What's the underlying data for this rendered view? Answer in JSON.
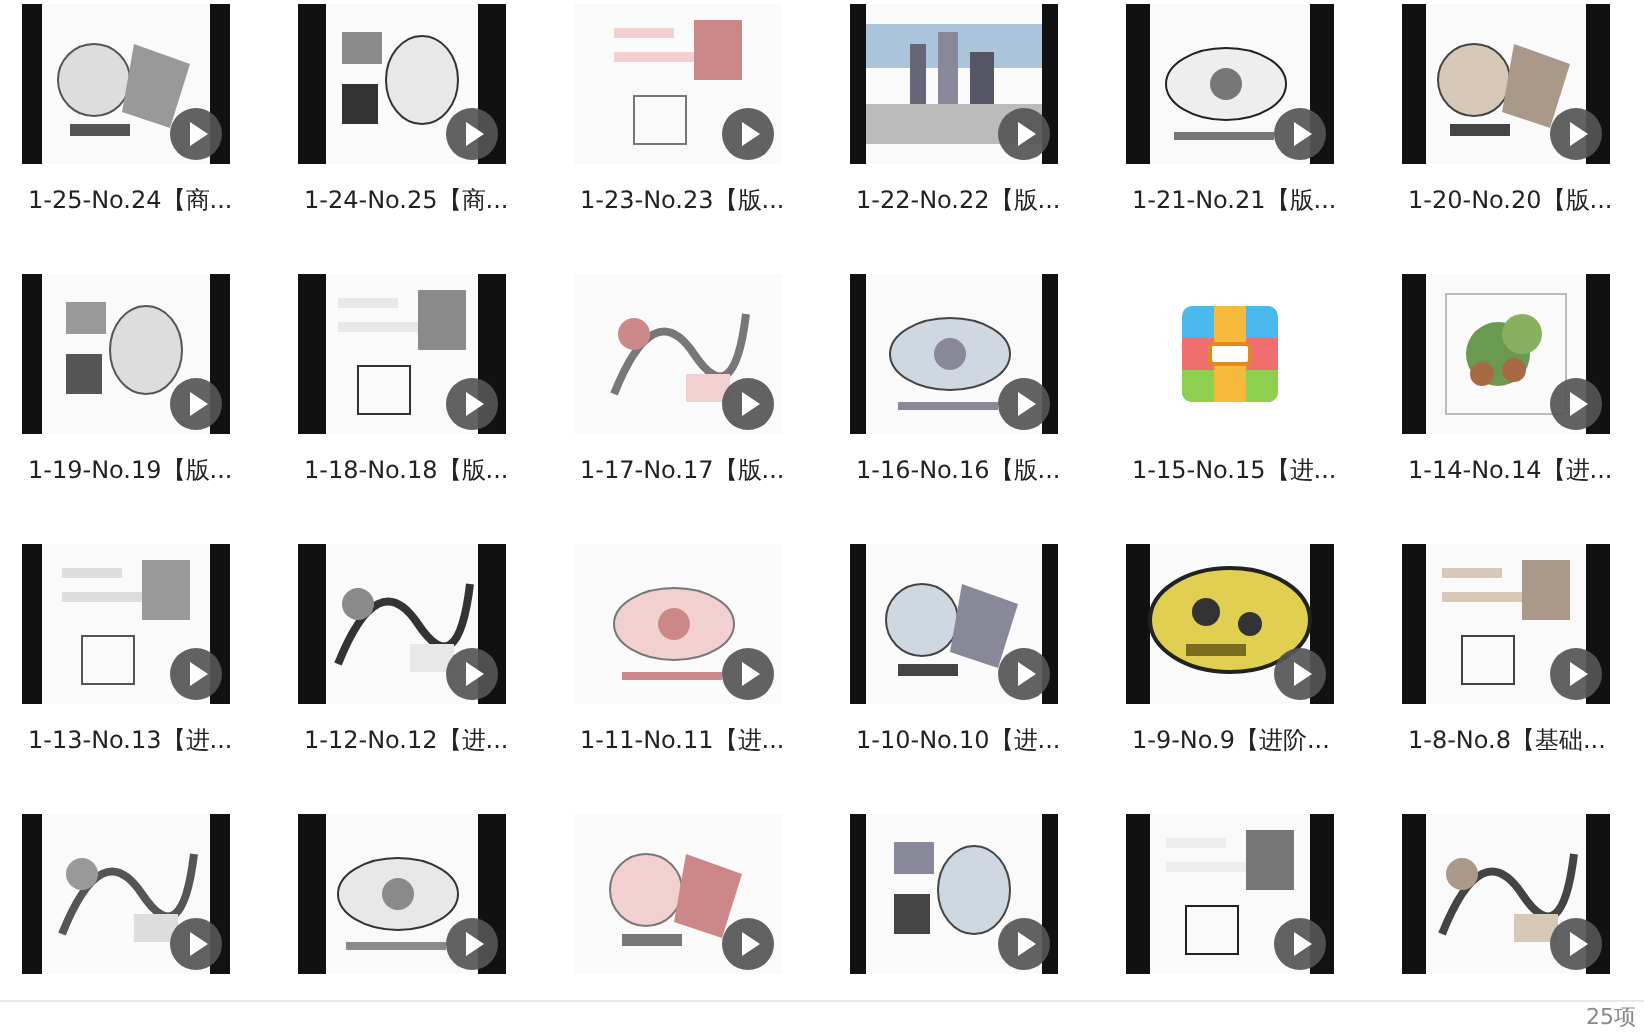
{
  "items": [
    {
      "name": "1-25-No.24【商...",
      "kind": "video"
    },
    {
      "name": "1-24-No.25【商...",
      "kind": "video"
    },
    {
      "name": "1-23-No.23【版...",
      "kind": "video"
    },
    {
      "name": "1-22-No.22【版...",
      "kind": "video"
    },
    {
      "name": "1-21-No.21【版...",
      "kind": "video"
    },
    {
      "name": "1-20-No.20【版...",
      "kind": "video"
    },
    {
      "name": "1-19-No.19【版...",
      "kind": "video"
    },
    {
      "name": "1-18-No.18【版...",
      "kind": "video"
    },
    {
      "name": "1-17-No.17【版...",
      "kind": "video"
    },
    {
      "name": "1-16-No.16【版...",
      "kind": "video"
    },
    {
      "name": "1-15-No.15【进...",
      "kind": "archive"
    },
    {
      "name": "1-14-No.14【进...",
      "kind": "video"
    },
    {
      "name": "1-13-No.13【进...",
      "kind": "video"
    },
    {
      "name": "1-12-No.12【进...",
      "kind": "video"
    },
    {
      "name": "1-11-No.11【进...",
      "kind": "video"
    },
    {
      "name": "1-10-No.10【进...",
      "kind": "video"
    },
    {
      "name": "1-9-No.9【进阶...",
      "kind": "video"
    },
    {
      "name": "1-8-No.8【基础...",
      "kind": "video"
    },
    {
      "kind": "video"
    },
    {
      "kind": "video"
    },
    {
      "kind": "video"
    },
    {
      "kind": "video"
    },
    {
      "kind": "video"
    },
    {
      "kind": "video"
    }
  ],
  "status_bar": {
    "count": "25项"
  }
}
